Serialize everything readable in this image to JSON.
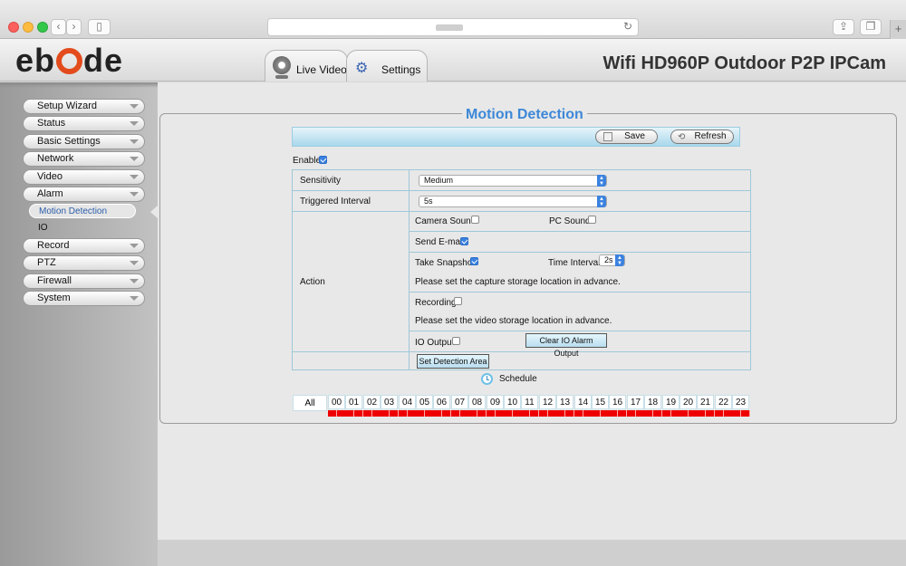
{
  "browser": {
    "back_label": "‹",
    "forward_label": "›",
    "sidebar_toggle_label": "▯",
    "reload_glyph": "↻",
    "share_glyph": "⇪",
    "tabs_glyph": "❐",
    "newtab_glyph": "+"
  },
  "header": {
    "logo_prefix": "eb",
    "logo_suffix": "de",
    "title": "Wifi HD960P Outdoor P2P IPCam",
    "tabs": [
      {
        "label": "Live Video",
        "icon": "camera-icon"
      },
      {
        "label": "Settings",
        "icon": "gear-icon"
      }
    ]
  },
  "sidebar": {
    "items": [
      {
        "label": "Setup Wizard"
      },
      {
        "label": "Status"
      },
      {
        "label": "Basic Settings"
      },
      {
        "label": "Network"
      },
      {
        "label": "Video"
      },
      {
        "label": "Alarm"
      },
      {
        "label": "Record"
      },
      {
        "label": "PTZ"
      },
      {
        "label": "Firewall"
      },
      {
        "label": "System"
      }
    ],
    "alarm_sub": [
      {
        "label": "Motion Detection",
        "active": true
      },
      {
        "label": "IO",
        "active": false
      }
    ]
  },
  "page": {
    "title": "Motion Detection",
    "save_label": "Save",
    "refresh_label": "Refresh",
    "enable_label": "Enable",
    "enable_checked": true
  },
  "form": {
    "sensitivity_label": "Sensitivity",
    "sensitivity_value": "Medium",
    "interval_label": "Triggered Interval",
    "interval_value": "5s",
    "action_label": "Action",
    "camera_sound_label": "Camera Sound",
    "camera_sound_checked": false,
    "pc_sound_label": "PC Sound",
    "pc_sound_checked": false,
    "send_email_label": "Send E-mail",
    "send_email_checked": true,
    "take_snapshot_label": "Take Snapshot",
    "take_snapshot_checked": true,
    "time_interval_label": "Time Interval",
    "time_interval_value": "2s",
    "snapshot_note": "Please set the capture storage location in advance.",
    "recording_label": "Recording",
    "recording_checked": false,
    "recording_note": "Please set the video storage location in advance.",
    "io_output_label": "IO Output",
    "io_output_checked": false,
    "clear_io_label": "Clear IO Alarm Output",
    "set_area_label": "Set Detection Area"
  },
  "schedule": {
    "label": "Schedule",
    "all_label": "All",
    "hours": [
      "00",
      "01",
      "02",
      "03",
      "04",
      "05",
      "06",
      "07",
      "08",
      "09",
      "10",
      "11",
      "12",
      "13",
      "14",
      "15",
      "16",
      "17",
      "18",
      "19",
      "20",
      "21",
      "22",
      "23"
    ],
    "active_color": "#ee0000"
  }
}
